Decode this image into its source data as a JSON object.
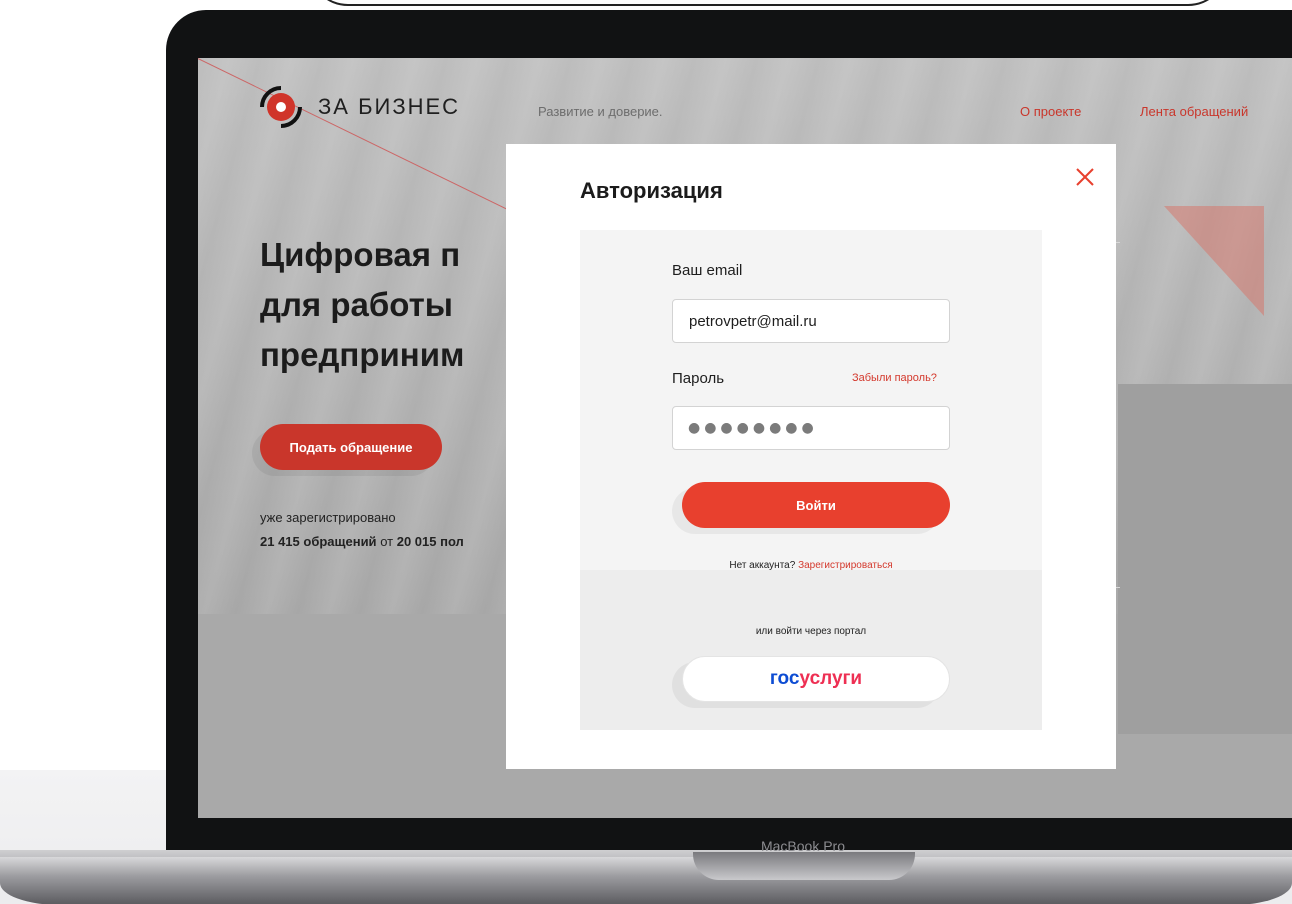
{
  "site": {
    "brand": "ЗА БИЗНЕС",
    "tagline": "Развитие и доверие.",
    "nav": [
      {
        "label": "О проекте"
      },
      {
        "label": "Лента обращений"
      }
    ]
  },
  "hero": {
    "title_lines": [
      "Цифровая п",
      "для работы",
      "предприним"
    ],
    "cta_label": "Подать обращение",
    "stat_line1": "уже зарегистрировано",
    "stat_count": "21 415 обращений",
    "stat_from": "от",
    "stat_users": "20 015 пол"
  },
  "modal": {
    "title": "Авторизация",
    "email_label": "Ваш email",
    "email_value": "petrovpetr@mail.ru",
    "password_label": "Пароль",
    "forgot_link": "Забыли пароль?",
    "password_mask": "●●●●●●●●",
    "login_button": "Войти",
    "no_account": "Нет аккаунта?",
    "signup_link": "Зарегистрироваться",
    "alt_login_label": "или войти через портал",
    "gosuslugi_part1": "гос",
    "gosuslugi_part2": "услуги"
  },
  "device": {
    "label": "MacBook Pro"
  },
  "colors": {
    "accent": "#e8402e",
    "brand_red": "#c9362b",
    "gosuslugi_blue": "#0d4cd3",
    "gosuslugi_red": "#ee2f53"
  },
  "icons": {
    "close": "close-icon",
    "logo": "logo-icon"
  }
}
